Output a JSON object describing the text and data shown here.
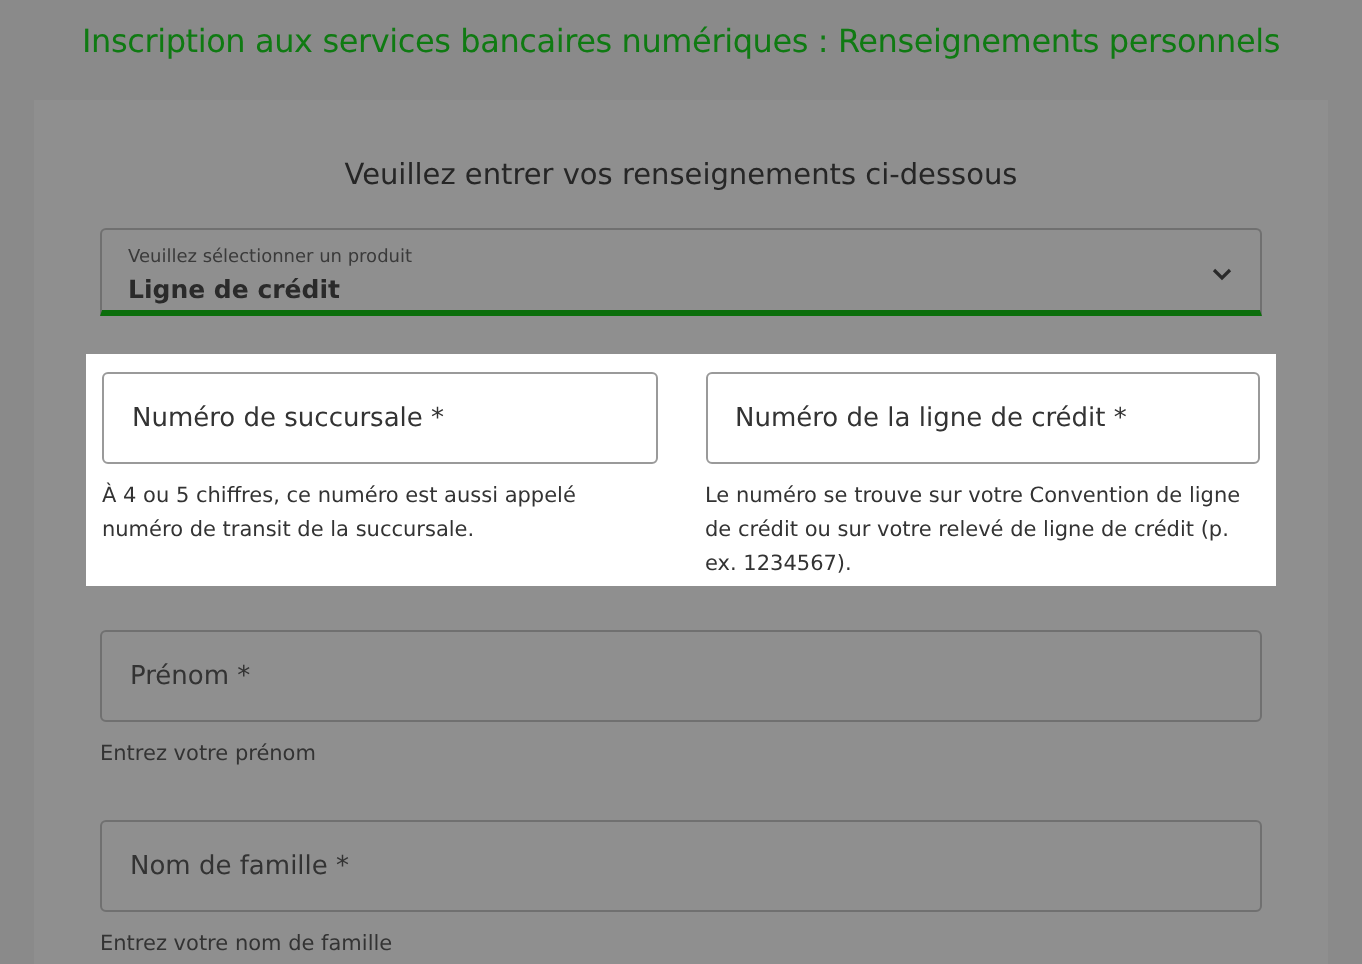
{
  "page_title": "Inscription aux services bancaires numériques : Renseignements personnels",
  "form": {
    "heading": "Veuillez entrer vos renseignements ci-dessous",
    "product_select": {
      "label": "Veuillez sélectionner un produit",
      "value": "Ligne de crédit"
    },
    "highlighted_fields": [
      {
        "placeholder": "Numéro de succursale *",
        "hint": "À 4 ou 5 chiffres, ce numéro est aussi appelé numéro de transit de la succursale."
      },
      {
        "placeholder": "Numéro de la ligne de crédit *",
        "hint": "Le numéro se trouve sur votre Convention de ligne de crédit ou sur votre relevé de ligne de crédit (p. ex. 1234567)."
      }
    ],
    "fields": [
      {
        "placeholder": "Prénom *",
        "hint": "Entrez votre prénom"
      },
      {
        "placeholder": "Nom de famille *",
        "hint": "Entrez votre nom de famille"
      }
    ]
  }
}
